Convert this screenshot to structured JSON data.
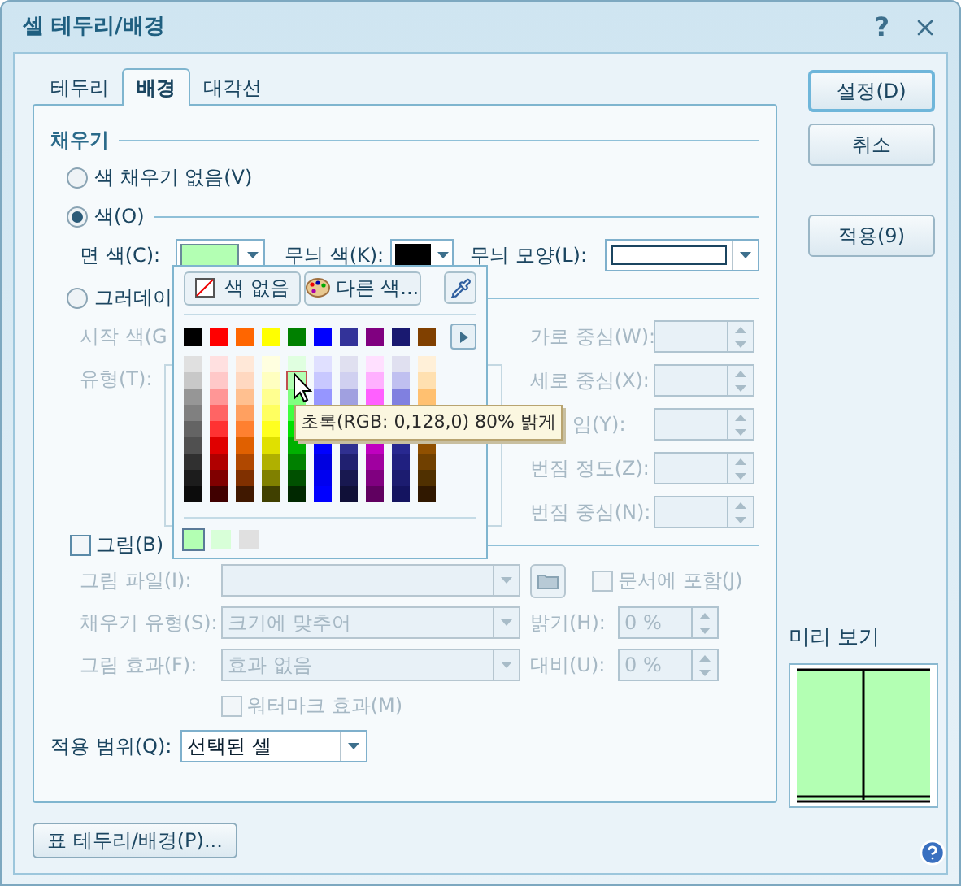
{
  "window": {
    "title": "셀 테두리/배경",
    "help": "?"
  },
  "tabs": [
    {
      "label": "테두리",
      "selected": false
    },
    {
      "label": "배경",
      "selected": true
    },
    {
      "label": "대각선",
      "selected": false
    }
  ],
  "fill": {
    "title": "채우기",
    "options": [
      {
        "label": "색 채우기 없음(V)",
        "selected": false
      },
      {
        "label": "색(O)",
        "selected": true
      }
    ],
    "face_color": {
      "label": "면 색(C):",
      "color": "#b3ffb3"
    },
    "pattern_color": {
      "label": "무늬 색(K):",
      "color": "#000000"
    },
    "pattern_shape": {
      "label": "무늬 모양(L):"
    },
    "gradient": {
      "label": "그러데이",
      "selected": false,
      "disabled": true,
      "start_label": "시작 색(G",
      "type_label": "유형(T):",
      "fields": [
        {
          "label": "가로 중심(W):",
          "covered": false
        },
        {
          "label": "세로 중심(X):",
          "covered": false
        },
        {
          "label": "임(Y):",
          "covered": true
        },
        {
          "label": "번짐 정도(Z):",
          "covered": false
        },
        {
          "label": "번짐 중심(N):",
          "covered": false
        }
      ]
    }
  },
  "picture": {
    "label": "그림(B)",
    "checked": false,
    "disabled": true,
    "file_label": "그림 파일(I):",
    "embed": {
      "label": "문서에 포함(J)",
      "checked": false
    },
    "fill_type": {
      "label": "채우기 유형(S):",
      "value": "크기에 맞추어"
    },
    "brightness": {
      "label": "밝기(H):",
      "value": "0 %"
    },
    "effect": {
      "label": "그림 효과(F):",
      "value": "효과 없음"
    },
    "contrast": {
      "label": "대비(U):",
      "value": "0 %"
    },
    "watermark": {
      "label": "워터마크 효과(M)",
      "checked": false
    }
  },
  "apply_scope": {
    "label": "적용 범위(Q):",
    "value": "선택된 셀"
  },
  "buttons": [
    {
      "label": "설정(D)",
      "default": true
    },
    {
      "label": "취소",
      "default": false
    },
    {
      "label": "적용(9)",
      "default": false
    }
  ],
  "preview": {
    "label": "미리 보기"
  },
  "table_button": "표 테두리/배경(P)...",
  "palette": {
    "no_color": "색 없음",
    "more_colors": "다른 색...",
    "base_colors": [
      {
        "color": "#000000"
      },
      {
        "color": "#ff0000"
      },
      {
        "color": "#ff6600"
      },
      {
        "color": "#ffff00"
      },
      {
        "color": "#008000"
      },
      {
        "color": "#0000ff"
      },
      {
        "color": "#333399"
      },
      {
        "color": "#800080"
      },
      {
        "color": "#191970"
      },
      {
        "color": "#804000"
      }
    ],
    "shades": [
      {
        "cells": [
          {
            "color": "#e0e0e0",
            "hovered": false
          },
          {
            "color": "#c8c8c8",
            "hovered": false
          },
          {
            "color": "#969696",
            "hovered": false
          },
          {
            "color": "#808080",
            "hovered": false
          },
          {
            "color": "#646464",
            "hovered": false
          },
          {
            "color": "#505050",
            "hovered": false
          },
          {
            "color": "#303030",
            "hovered": false
          },
          {
            "color": "#1c1c1c",
            "hovered": false
          },
          {
            "color": "#0c0c0c",
            "hovered": false
          }
        ]
      },
      {
        "cells": [
          {
            "color": "#ffe0e0",
            "hovered": false
          },
          {
            "color": "#ffc8c8",
            "hovered": false
          },
          {
            "color": "#ff9696",
            "hovered": false
          },
          {
            "color": "#ff6464",
            "hovered": false
          },
          {
            "color": "#ff3232",
            "hovered": false
          },
          {
            "color": "#e00000",
            "hovered": false
          },
          {
            "color": "#b00000",
            "hovered": false
          },
          {
            "color": "#800000",
            "hovered": false
          },
          {
            "color": "#400000",
            "hovered": false
          }
        ]
      },
      {
        "cells": [
          {
            "color": "#ffe8d8",
            "hovered": false
          },
          {
            "color": "#ffd8c0",
            "hovered": false
          },
          {
            "color": "#ffc090",
            "hovered": false
          },
          {
            "color": "#ffa060",
            "hovered": false
          },
          {
            "color": "#ff8030",
            "hovered": false
          },
          {
            "color": "#e06000",
            "hovered": false
          },
          {
            "color": "#b04800",
            "hovered": false
          },
          {
            "color": "#803000",
            "hovered": false
          },
          {
            "color": "#401800",
            "hovered": false
          }
        ]
      },
      {
        "cells": [
          {
            "color": "#ffffe0",
            "hovered": false
          },
          {
            "color": "#ffffc0",
            "hovered": false
          },
          {
            "color": "#ffff90",
            "hovered": false
          },
          {
            "color": "#ffff60",
            "hovered": false
          },
          {
            "color": "#ffff20",
            "hovered": false
          },
          {
            "color": "#e0e000",
            "hovered": false
          },
          {
            "color": "#b0b000",
            "hovered": false
          },
          {
            "color": "#808000",
            "hovered": false
          },
          {
            "color": "#404000",
            "hovered": false
          }
        ]
      },
      {
        "cells": [
          {
            "color": "#e0ffe0",
            "hovered": false
          },
          {
            "color": "#b3ffb3",
            "hovered": true
          },
          {
            "color": "#80ff80",
            "hovered": false
          },
          {
            "color": "#40ff40",
            "hovered": false
          },
          {
            "color": "#00e000",
            "hovered": false
          },
          {
            "color": "#00b000",
            "hovered": false
          },
          {
            "color": "#008000",
            "hovered": false
          },
          {
            "color": "#005000",
            "hovered": false
          },
          {
            "color": "#002800",
            "hovered": false
          }
        ]
      },
      {
        "cells": [
          {
            "color": "#e0e0ff",
            "hovered": false
          },
          {
            "color": "#c8c8ff",
            "hovered": false
          },
          {
            "color": "#9696ff",
            "hovered": false
          },
          {
            "color": "#0000ff",
            "hovered": false
          },
          {
            "color": "#0000e0",
            "hovered": false
          },
          {
            "color": "#0000f0",
            "hovered": false
          },
          {
            "color": "#0000ff",
            "hovered": false
          }
        ]
      },
      {
        "cells": [
          {
            "color": "#e0e0f0",
            "hovered": false
          },
          {
            "color": "#d0d0f0",
            "hovered": false
          },
          {
            "color": "#a0a0e0",
            "hovered": false
          },
          {
            "color": "#303090",
            "hovered": false
          },
          {
            "color": "#202070",
            "hovered": false
          },
          {
            "color": "#181850",
            "hovered": false
          },
          {
            "color": "#101038",
            "hovered": false
          }
        ]
      },
      {
        "cells": [
          {
            "color": "#ffe0ff",
            "hovered": false
          },
          {
            "color": "#ffb0ff",
            "hovered": false
          },
          {
            "color": "#ff60ff",
            "hovered": false
          },
          {
            "color": "#c000c0",
            "hovered": false
          },
          {
            "color": "#a000a0",
            "hovered": false
          },
          {
            "color": "#800080",
            "hovered": false
          },
          {
            "color": "#600060",
            "hovered": false
          }
        ]
      },
      {
        "cells": [
          {
            "color": "#e0e0f0",
            "hovered": false
          },
          {
            "color": "#c0c0f0",
            "hovered": false
          },
          {
            "color": "#8080e0",
            "hovered": false
          },
          {
            "color": "#282890",
            "hovered": false
          },
          {
            "color": "#202080",
            "hovered": false
          },
          {
            "color": "#1c1c70",
            "hovered": false
          },
          {
            "color": "#141460",
            "hovered": false
          }
        ]
      },
      {
        "cells": [
          {
            "color": "#fff0d8",
            "hovered": false
          },
          {
            "color": "#ffe0b0",
            "hovered": false
          },
          {
            "color": "#ffc070",
            "hovered": false
          },
          {
            "color": "#905000",
            "hovered": false
          },
          {
            "color": "#704000",
            "hovered": false
          },
          {
            "color": "#503000",
            "hovered": false
          },
          {
            "color": "#301800",
            "hovered": false
          }
        ]
      }
    ],
    "recent": [
      {
        "color": "#b3ffb3",
        "selected": true
      },
      {
        "color": "#d8ffd8",
        "selected": false
      },
      {
        "color": "#e0e0e0",
        "selected": false
      }
    ]
  },
  "tooltip": "초록(RGB: 0,128,0) 80% 밝게"
}
